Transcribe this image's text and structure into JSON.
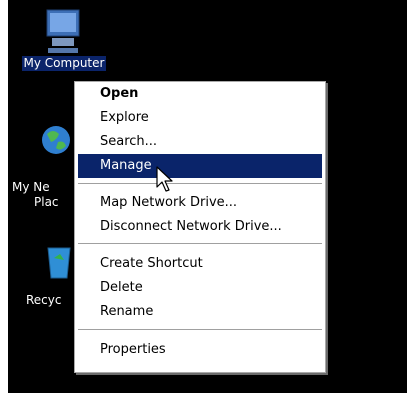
{
  "desktop": {
    "icons": [
      {
        "label": "My Computer"
      },
      {
        "label": "My Ne"
      },
      {
        "label": "Plac"
      },
      {
        "label": "Recyc"
      }
    ]
  },
  "context_menu": {
    "items": [
      {
        "label": "Open"
      },
      {
        "label": "Explore"
      },
      {
        "label": "Search..."
      },
      {
        "label": "Manage"
      },
      {
        "label": "Map Network Drive..."
      },
      {
        "label": "Disconnect Network Drive..."
      },
      {
        "label": "Create Shortcut"
      },
      {
        "label": "Delete"
      },
      {
        "label": "Rename"
      },
      {
        "label": "Properties"
      }
    ]
  },
  "colors": {
    "desktop_bg": "#000000",
    "highlight": "#0a246a"
  },
  "cursor": "arrow-pointer-icon"
}
